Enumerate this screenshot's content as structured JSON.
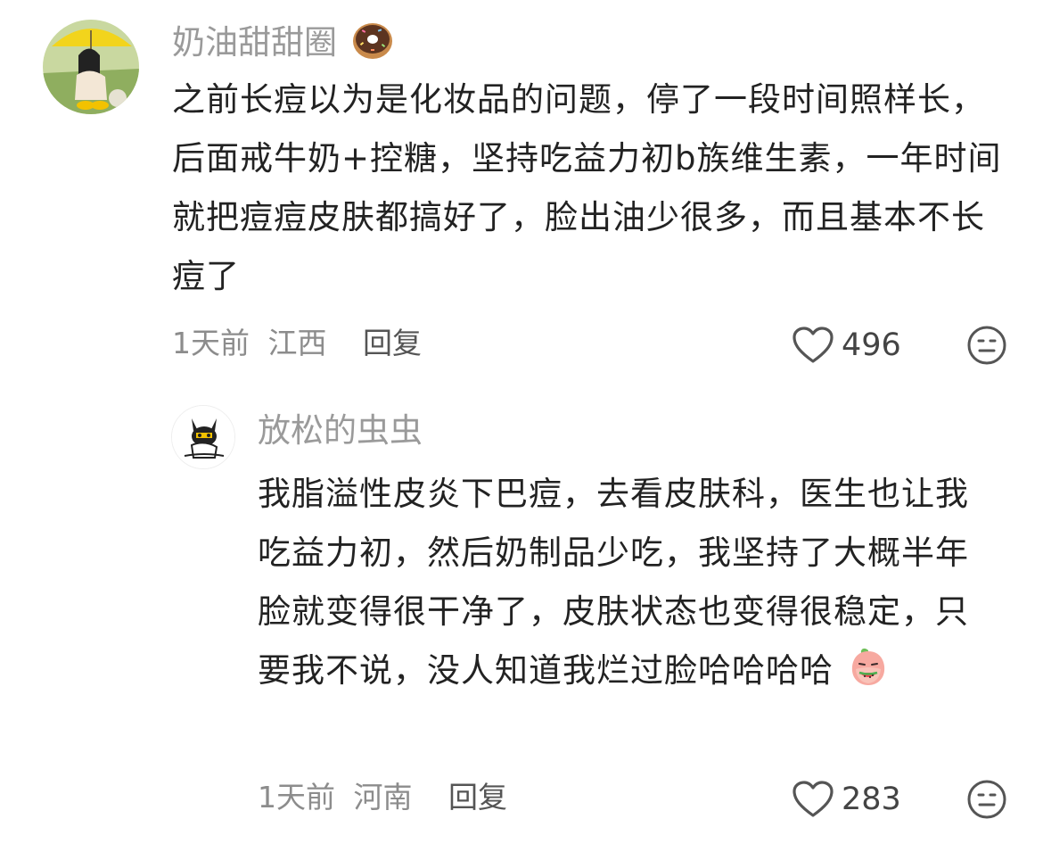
{
  "comments": [
    {
      "username": "奶油甜甜圈",
      "username_emoji": "donut-emoji",
      "text": "之前长痘以为是化妆品的问题，停了一段时间照样长，后面戒牛奶+控糖，坚持吃益力初b族维生素，一年时间就把痘痘皮肤都搞好了，脸出油少很多，而且基本不长痘了",
      "time": "1天前",
      "location": "江西",
      "reply_label": "回复",
      "likes": "496"
    },
    {
      "username": "放松的虫虫",
      "text": "我脂溢性皮炎下巴痘，去看皮肤科，医生也让我吃益力初，然后奶制品少吃，我坚持了大概半年脸就变得很干净了，皮肤状态也变得很稳定，只要我不说，没人知道我烂过脸哈哈哈哈",
      "text_emoji": "peach-eating-watermelon-emoji",
      "time": "1天前",
      "location": "河南",
      "reply_label": "回复",
      "likes": "283"
    }
  ],
  "icons": {
    "like": "heart-outline-icon",
    "emoji_reaction": "smiley-face-icon"
  },
  "colors": {
    "username": "#9a9a9a",
    "text": "#222222",
    "meta": "#8c8c8c",
    "icon": "#555555"
  }
}
